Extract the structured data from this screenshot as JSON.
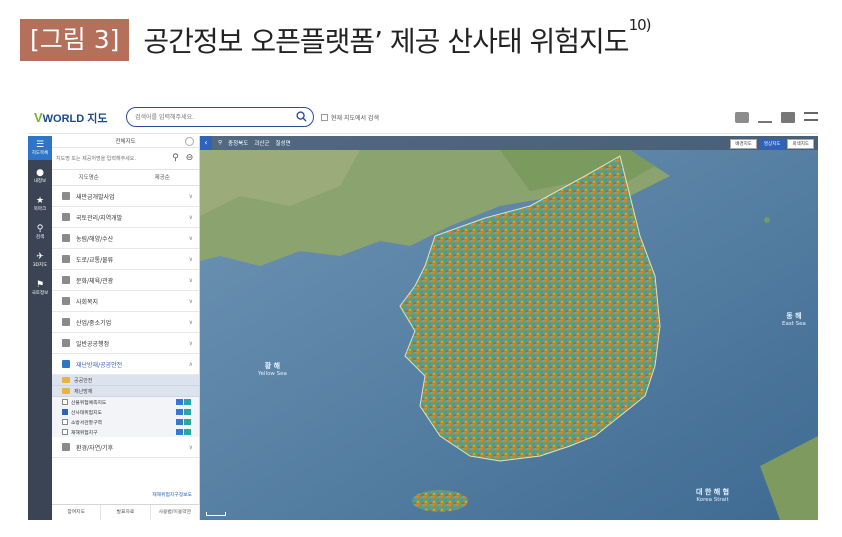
{
  "figure": {
    "tag": "[그림 3]",
    "title": "공간정보 오픈플랫폼’ 제공 산사태 위험지도",
    "footnote": "10)"
  },
  "app": {
    "logo_v": "V",
    "logo_text": "WORLD 지도",
    "search_placeholder": "검색어를 입력해주세요.",
    "current_map_search": "현재 지도에서 검색",
    "toolbar_icons": [
      "mail-icon",
      "download-icon",
      "print-icon",
      "menu-icon"
    ]
  },
  "rail": [
    {
      "icon": "layers-icon",
      "label": "지도목록",
      "active": true
    },
    {
      "icon": "person-icon",
      "label": "내정보"
    },
    {
      "icon": "star-icon",
      "label": "북마크"
    },
    {
      "icon": "search-icon",
      "label": "검색"
    },
    {
      "icon": "plane-icon",
      "label": "3D지도"
    },
    {
      "icon": "flag-icon",
      "label": "국토정보"
    }
  ],
  "panel": {
    "header": "전체지도",
    "search_placeholder": "지도명 또는 제공처명을 입력해주세요.",
    "tabs": [
      "지도명순",
      "제공순"
    ],
    "categories": [
      {
        "label": "새만금개발사업",
        "open": false
      },
      {
        "label": "국토관리/지역개발",
        "open": false
      },
      {
        "label": "농림/해양/수산",
        "open": false
      },
      {
        "label": "도로/교통/물류",
        "open": false
      },
      {
        "label": "문화/체육/관광",
        "open": false
      },
      {
        "label": "사회복지",
        "open": false
      },
      {
        "label": "산업/중소기업",
        "open": false
      },
      {
        "label": "일반공공행정",
        "open": false
      },
      {
        "label": "재난방재/공공안전",
        "open": true
      }
    ],
    "folders": [
      "공공안전",
      "재난방재"
    ],
    "layers": [
      {
        "label": "산불위험예측지도",
        "checked": false
      },
      {
        "label": "산사태위험지도",
        "checked": true
      },
      {
        "label": "소방서관할구역",
        "checked": false
      },
      {
        "label": "재해위험지구",
        "checked": false
      }
    ],
    "last_category": "환경/자연/기후",
    "footer_link": "재해위험지구정보도",
    "footer_tabs": [
      "참여지도",
      "발표자료",
      "사용법/이용약관"
    ]
  },
  "map": {
    "breadcrumb": [
      "충청북도",
      "괴산군",
      "칠성면"
    ],
    "basemaps": [
      {
        "label": "배경지도",
        "selected": false
      },
      {
        "label": "영상지도",
        "selected": true
      },
      {
        "label": "회색지도",
        "selected": false
      }
    ],
    "labels": {
      "yellow_sea": "황 해",
      "yellow_sea_en": "Yellow Sea",
      "east_sea": "동 해",
      "east_sea_en": "East Sea",
      "korea_strait": "대 한 해 협",
      "korea_strait_en": "Korea Strait"
    }
  }
}
